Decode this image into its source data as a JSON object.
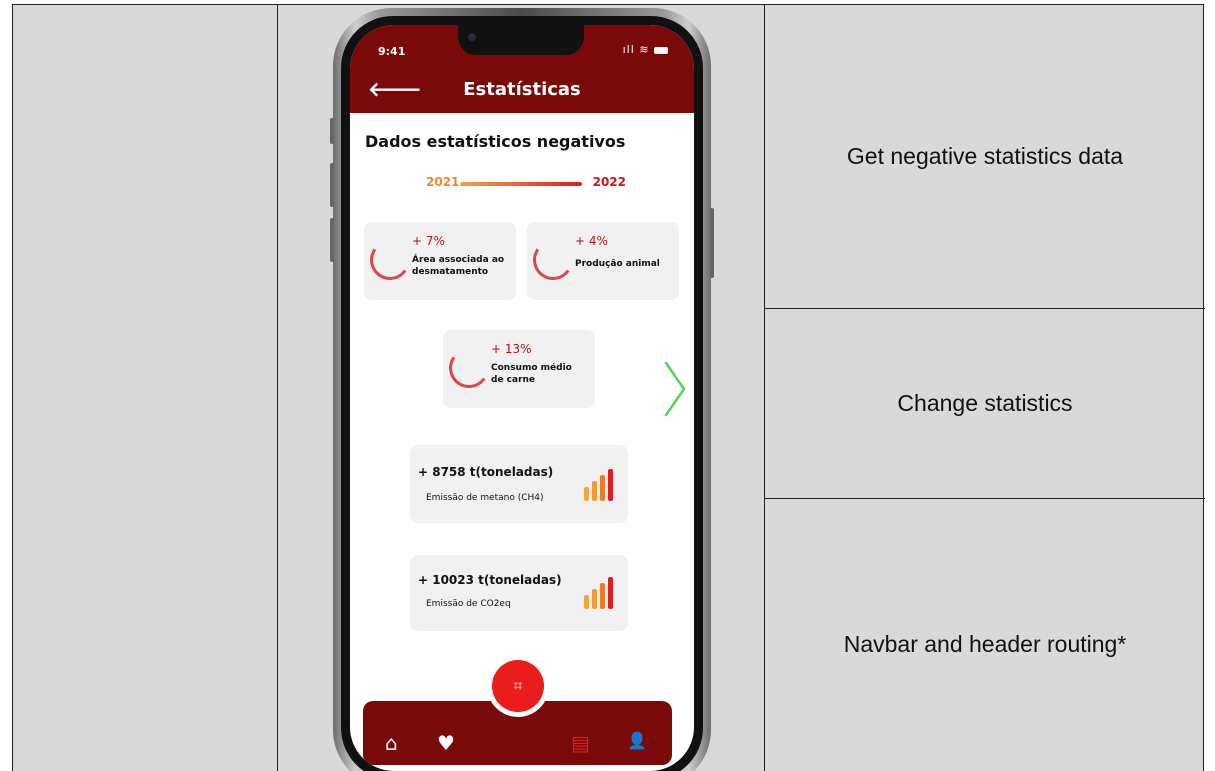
{
  "table": {
    "rows": [
      {
        "description": "Get negative statistics data"
      },
      {
        "description": "Change statistics"
      },
      {
        "description": "Navbar and header routing*"
      }
    ]
  },
  "phone": {
    "status": {
      "time": "9:41",
      "signal": "ıll",
      "wifi": "≋"
    },
    "header": {
      "back_icon": "arrow-left-icon",
      "back_glyph": "🡐",
      "title": "Estatísticas"
    },
    "section_title": "Dados estatísticos negativos",
    "years": {
      "from": "2021",
      "to": "2022"
    },
    "ring_cards": [
      {
        "pct": "+ 7%",
        "label_line1": "Área associada ao",
        "label_line2": "desmatamento"
      },
      {
        "pct": "+ 4%",
        "label_line1": "Produção animal",
        "label_line2": ""
      },
      {
        "pct": "+ 13%",
        "label_line1": "Consumo médio",
        "label_line2": "de carne"
      }
    ],
    "ton_cards": [
      {
        "value": "+ 8758 t(toneladas)",
        "label": "Emissão de metano (CH4)"
      },
      {
        "value": "+ 10023 t(toneladas)",
        "label": "Emissão de CO2eq"
      }
    ],
    "next_icon": "chevron-right-icon",
    "navbar": {
      "items": [
        {
          "icon": "home-icon",
          "glyph": "⌂"
        },
        {
          "icon": "heart-icon",
          "glyph": "♥"
        },
        {
          "icon": "news-icon",
          "glyph": "▤"
        },
        {
          "icon": "user-icon",
          "glyph": "👤"
        }
      ],
      "scan_icon": "scan-icon",
      "scan_glyph": "⌗"
    },
    "colors": {
      "primary": "#7a0a0a",
      "accent": "#ea1c1c",
      "year_from": "#ef8a2c",
      "year_to": "#d3141c"
    }
  }
}
